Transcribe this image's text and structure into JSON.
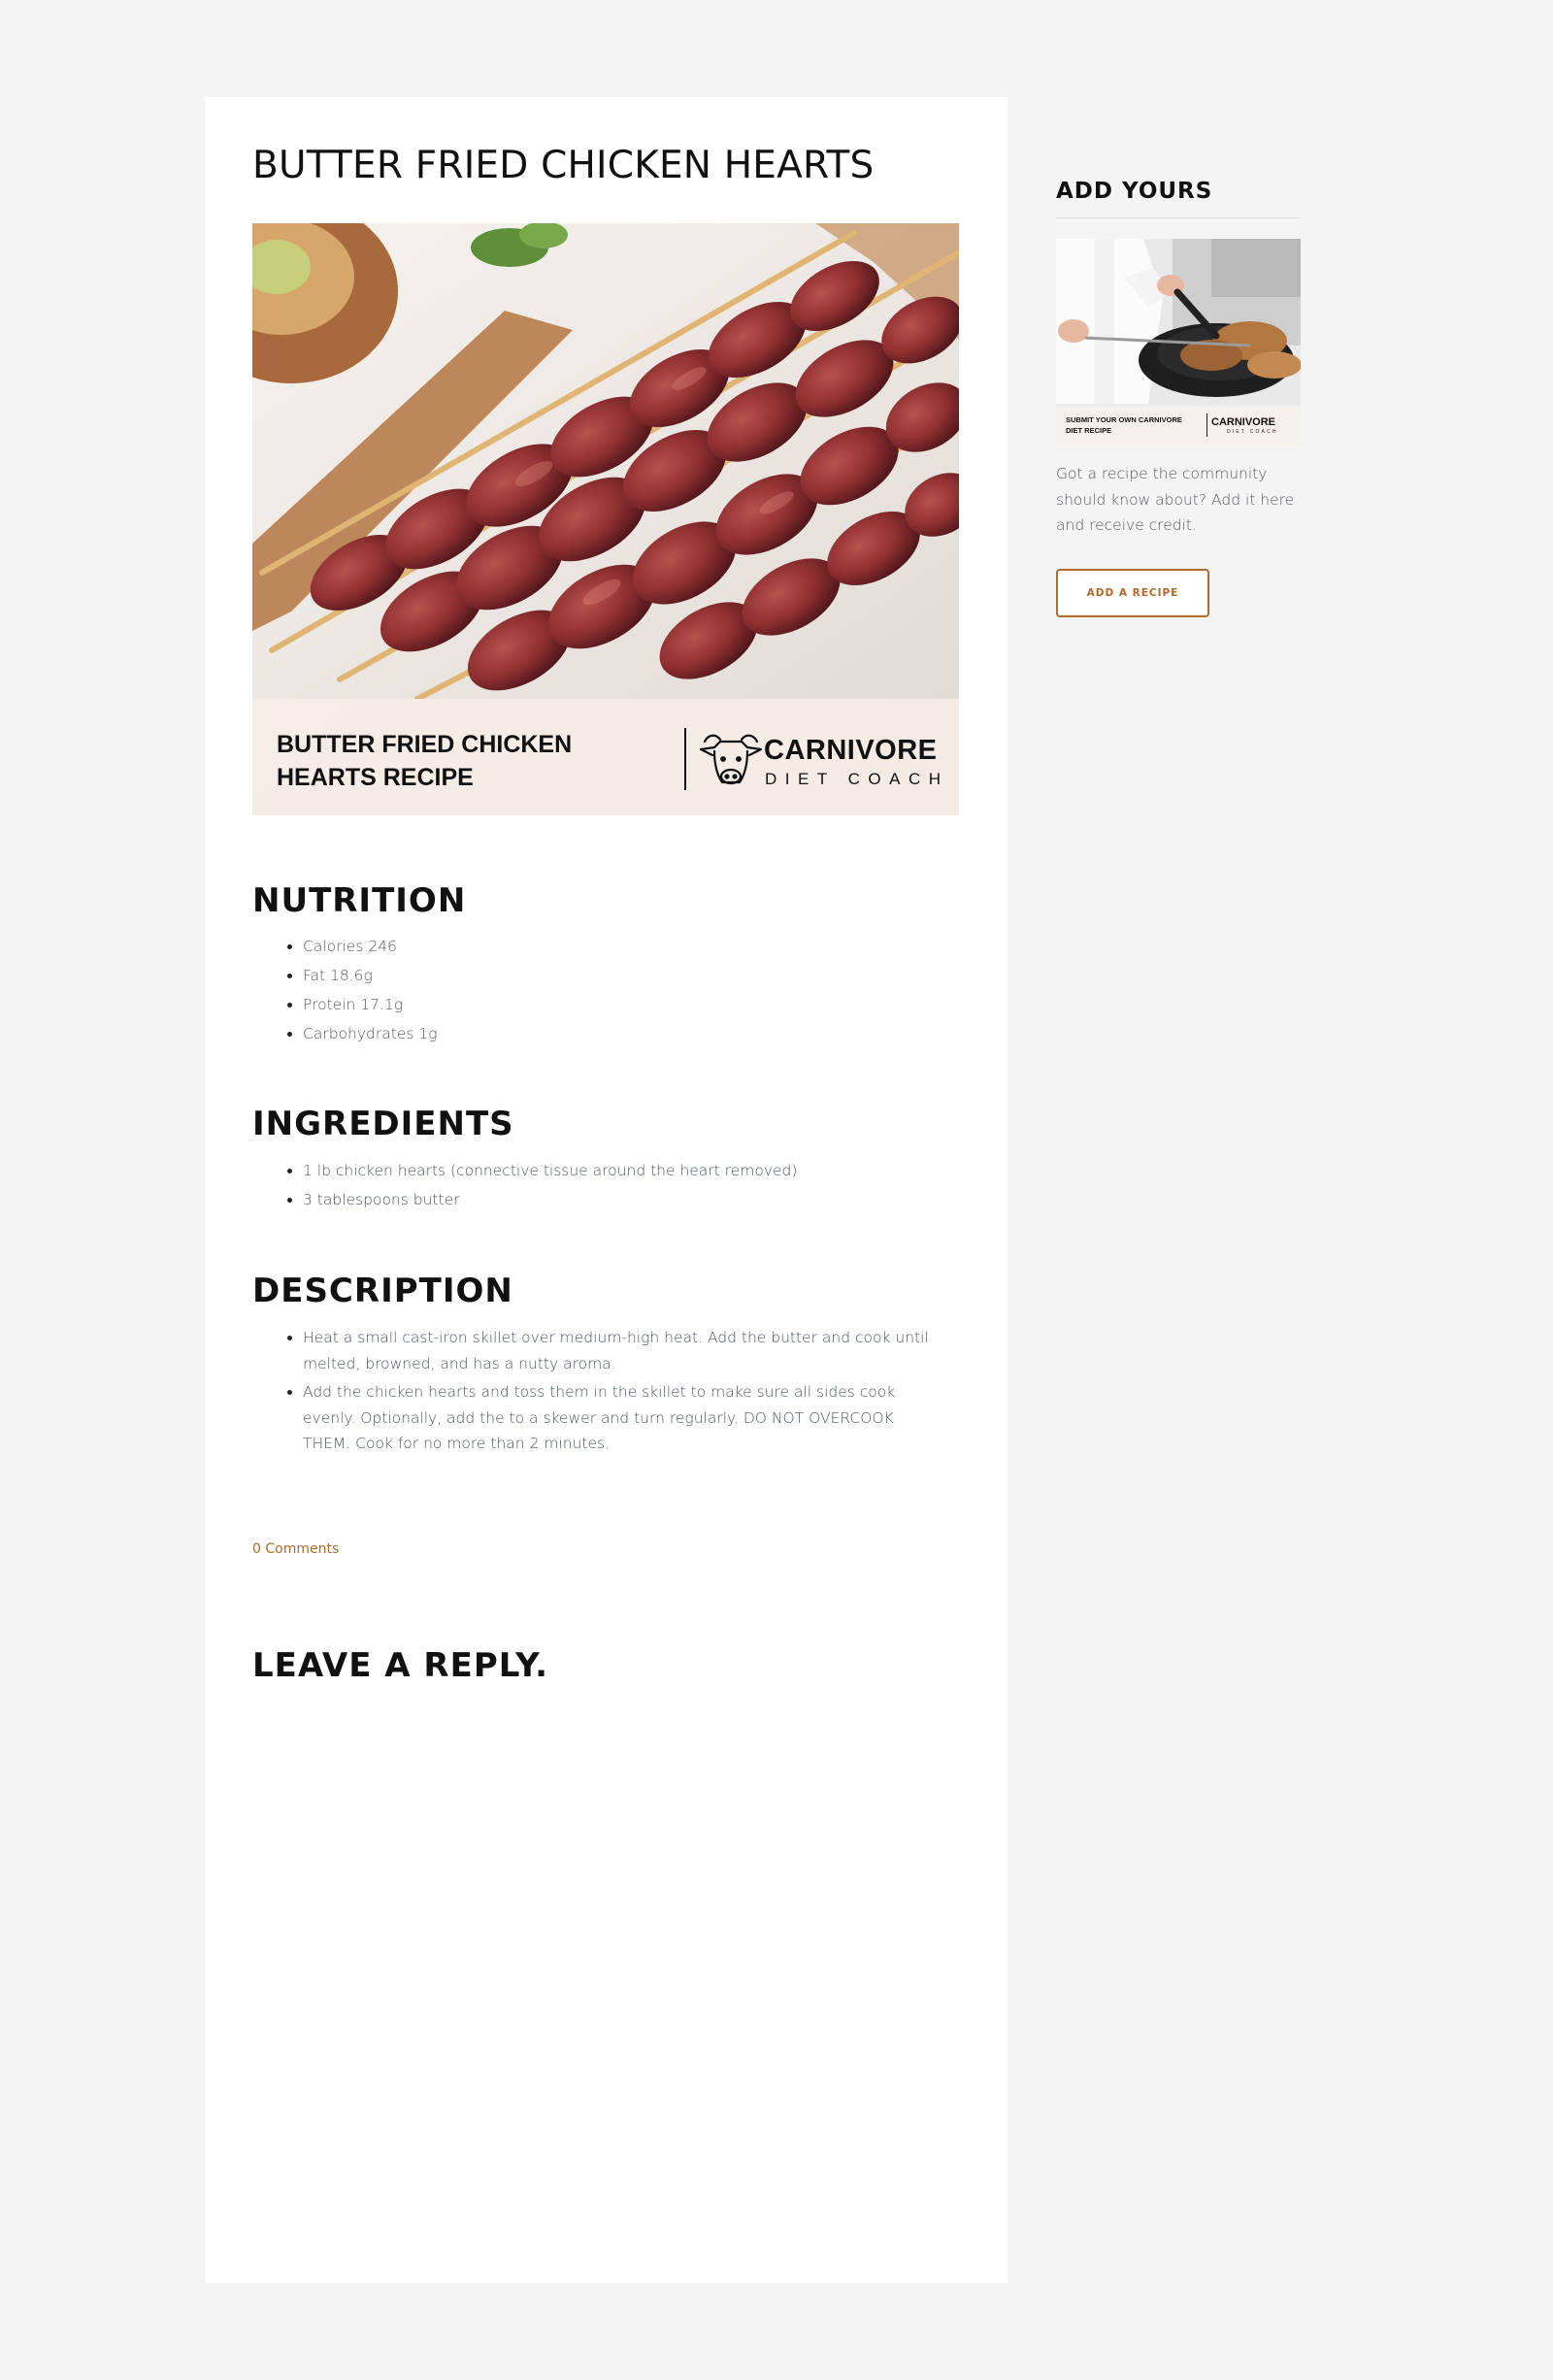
{
  "post": {
    "title": "BUTTER FRIED CHICKEN HEARTS",
    "hero": {
      "caption": "BUTTER FRIED CHICKEN HEARTS RECIPE",
      "brand": "CARNIVORE",
      "brand_sub": "DIET COACH"
    },
    "nutrition": {
      "heading": "NUTRITION",
      "items": [
        "Calories 246",
        "Fat 18.6g",
        "Protein 17.1g",
        "Carbohydrates 1g"
      ]
    },
    "ingredients": {
      "heading": "INGREDIENTS",
      "items": [
        "1 lb chicken hearts (connective tissue around the heart removed)",
        "3 tablespoons butter"
      ]
    },
    "description": {
      "heading": "DESCRIPTION",
      "items": [
        "Heat a small cast-iron skillet over medium-high heat. Add the butter and cook until melted, browned, and has a nutty aroma.",
        "Add the chicken hearts and toss them in the skillet to make sure all sides cook evenly. Optionally, add the to a skewer and turn regularly. DO NOT OVERCOOK THEM. Cook for no more than 2 minutes."
      ]
    },
    "comments_link": "0 Comments",
    "reply_heading": "LEAVE A REPLY."
  },
  "sidebar": {
    "widget_title": "ADD YOURS",
    "promo": {
      "caption": "SUBMIT YOUR OWN CARNIVORE DIET RECIPE",
      "brand": "CARNIVORE",
      "brand_sub": "DIET COACH"
    },
    "text": "Got a recipe the community should know about? Add it here and receive credit.",
    "button_label": "ADD A RECIPE"
  },
  "colors": {
    "page_background": "#f4f4f4",
    "card_background": "#ffffff",
    "accent": "#b06a2c",
    "body_text": "#555a60"
  }
}
